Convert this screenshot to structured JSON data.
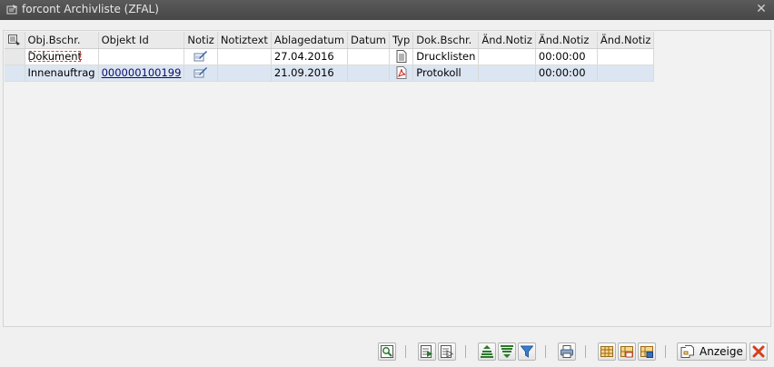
{
  "window": {
    "title": "forcont Archivliste (ZFAL)",
    "close_glyph": "✕"
  },
  "grid": {
    "columns": [
      "Obj.Bschr.",
      "Objekt Id",
      "Notiz",
      "Notiztext",
      "Ablagedatum",
      "Datum",
      "Typ",
      "Dok.Bschr.",
      "Änd.Notiz",
      "Änd.Notiz",
      "Änd.Notiz"
    ],
    "rows": [
      {
        "obj_bschr": "Dokument",
        "objekt_id": "",
        "notiz_icon": "note-edit-icon",
        "notiztext": "",
        "ablagedatum": "27.04.2016",
        "datum": "",
        "typ_icon": "document-list-icon",
        "dok_bschr": "Drucklisten",
        "aend_notiz_1": "",
        "aend_notiz_2": "00:00:00",
        "aend_notiz_3": ""
      },
      {
        "obj_bschr": "Innenauftrag",
        "objekt_id": "000000100199",
        "notiz_icon": "note-edit-icon",
        "notiztext": "",
        "ablagedatum": "21.09.2016",
        "datum": "",
        "typ_icon": "pdf-icon",
        "dok_bschr": "Protokoll",
        "aend_notiz_1": "",
        "aend_notiz_2": "00:00:00",
        "aend_notiz_3": ""
      }
    ]
  },
  "toolbar": {
    "buttons": [
      "details-icon",
      "select-all-icon",
      "deselect-all-icon",
      "sort-ascending-icon",
      "sort-descending-icon",
      "filter-icon",
      "print-icon",
      "layout-icon",
      "change-layout-icon",
      "save-layout-icon"
    ],
    "display_label": "Anzeige",
    "display_icon": "display-document-icon",
    "cancel_icon": "cancel-icon"
  },
  "colors": {
    "titlebar": "#4d4d4d",
    "selected_row": "#dce6f2",
    "cancel_red": "#d2401e"
  }
}
